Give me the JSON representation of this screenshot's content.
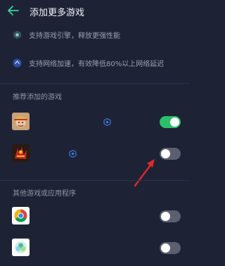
{
  "header": {
    "title": "添加更多游戏",
    "back_icon": "back-arrow-icon"
  },
  "features": [
    {
      "icon": "engine-icon",
      "text": "支持游戏引擎，释放更强性能"
    },
    {
      "icon": "network-accelerate-icon",
      "text": "支持网络加速，有效降低80%以上网络延迟"
    }
  ],
  "recommended": {
    "title": "推荐添加的游戏",
    "items": [
      {
        "icon": "game-app-icon",
        "accelerate_icon": "accelerate-badge-icon",
        "enabled": true
      },
      {
        "icon": "game-app-icon",
        "accelerate_icon": "accelerate-badge-icon",
        "enabled": false
      }
    ]
  },
  "others": {
    "title": "其他游戏或应用程序",
    "items": [
      {
        "icon": "chrome-app-icon",
        "enabled": false
      },
      {
        "icon": "gallery-app-icon",
        "enabled": false
      }
    ]
  },
  "annotation": {
    "icon": "red-arrow-icon",
    "color": "#e0282b"
  },
  "colors": {
    "background": "#1e2235",
    "accent": "#2bbf6a",
    "toggle_off": "#5b5f70"
  }
}
